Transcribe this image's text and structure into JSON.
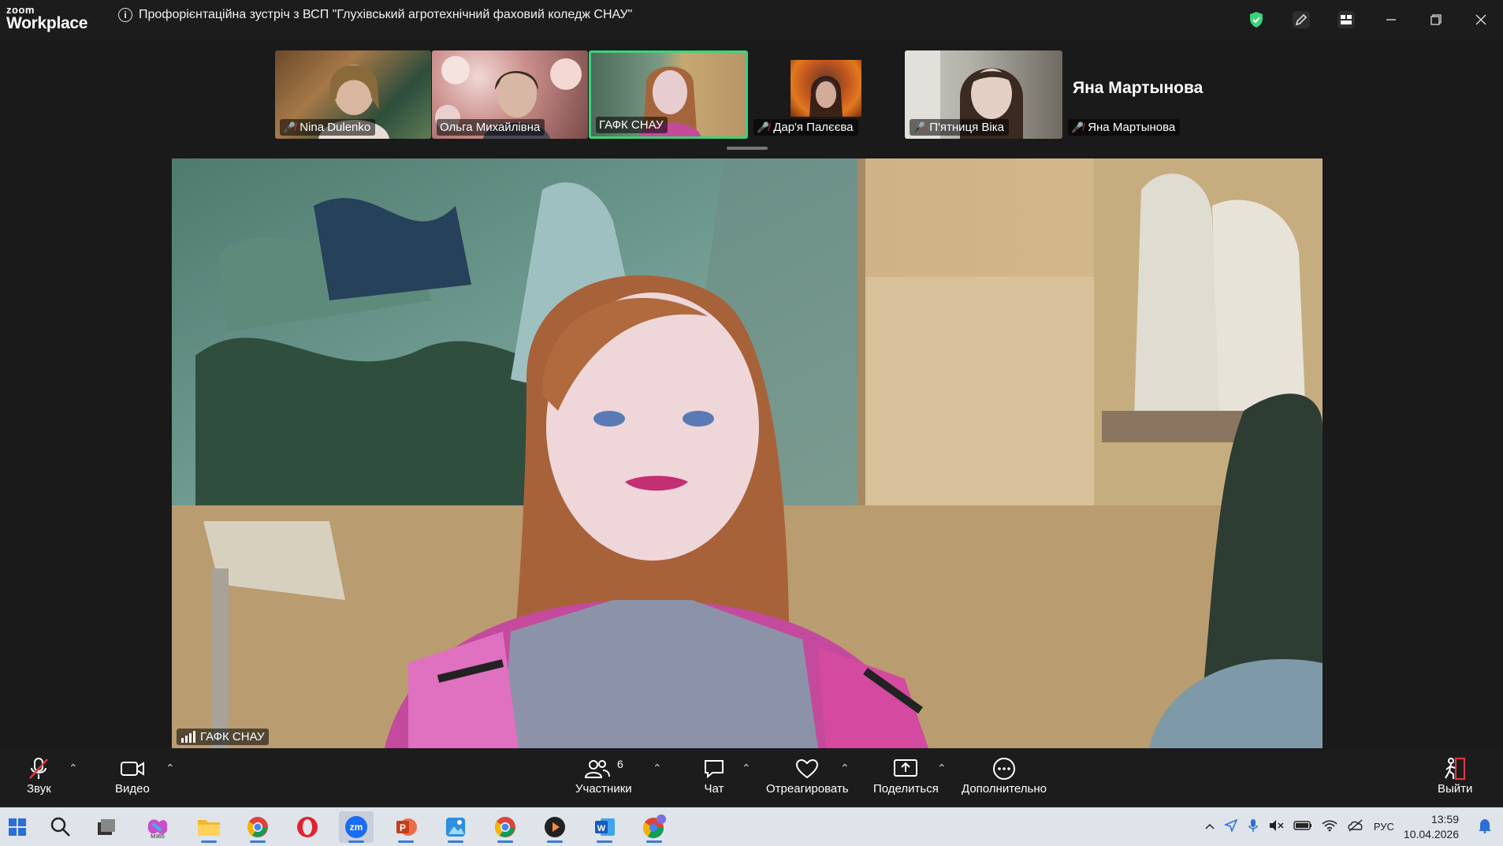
{
  "titlebar": {
    "logo_top": "zoom",
    "logo_bottom": "Workplace",
    "meeting_title": "Профорієнтаційна зустріч з ВСП \"Глухівський агротехнічний фаховий коледж СНАУ\""
  },
  "thumbnails": [
    {
      "name": "Nina Dulenko",
      "muted": true
    },
    {
      "name": "Ольга Михайлівна",
      "muted": false
    },
    {
      "name": "ГАФК СНАУ",
      "muted": false,
      "active": true
    },
    {
      "name": "Дар'я Палєєва",
      "muted": true
    },
    {
      "name": "П'ятниця  Віка",
      "muted": true
    },
    {
      "name": "Яна Мартынова",
      "muted": true,
      "display_name": "Яна Мартынова"
    }
  ],
  "main_video": {
    "label": "ГАФК СНАУ"
  },
  "toolbar": {
    "audio": "Звук",
    "video": "Видео",
    "participants": "Участники",
    "participants_count": "6",
    "chat": "Чат",
    "react": "Отреагировать",
    "share": "Поделиться",
    "more": "Дополнительно",
    "leave": "Выйти"
  },
  "taskbar": {
    "language": "РУС",
    "time": "13:59",
    "date": "10.04.2026",
    "m365_label": "M365"
  },
  "colors": {
    "accent_green": "#3cd37b",
    "mute_red": "#e0363e",
    "leave_red": "#e0363e"
  }
}
